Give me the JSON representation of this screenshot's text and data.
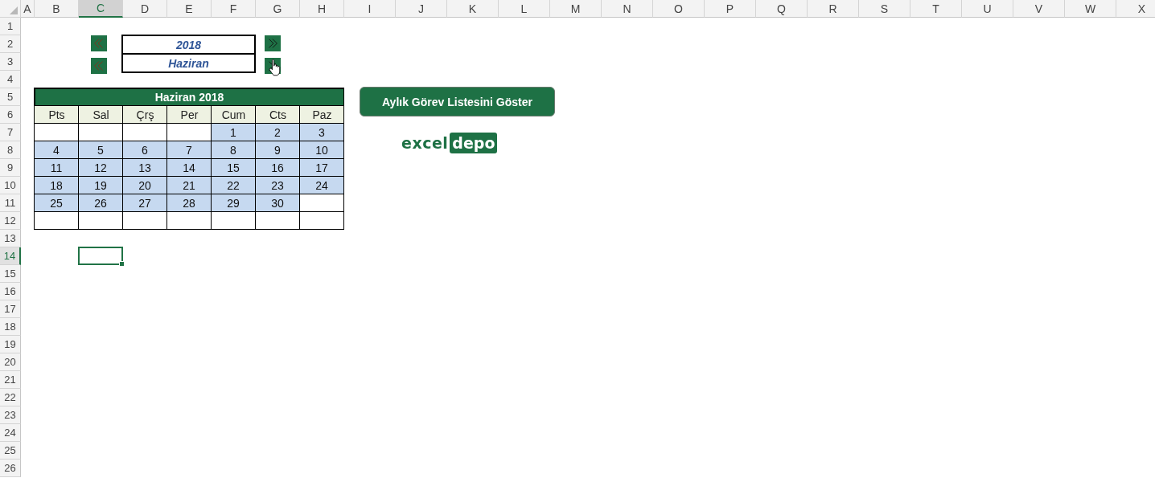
{
  "columns": [
    {
      "label": "A",
      "selected": false
    },
    {
      "label": "B",
      "selected": false
    },
    {
      "label": "C",
      "selected": true
    },
    {
      "label": "D",
      "selected": false
    },
    {
      "label": "E",
      "selected": false
    },
    {
      "label": "F",
      "selected": false
    },
    {
      "label": "G",
      "selected": false
    },
    {
      "label": "H",
      "selected": false
    },
    {
      "label": "I",
      "selected": false
    },
    {
      "label": "J",
      "selected": false
    },
    {
      "label": "K",
      "selected": false
    },
    {
      "label": "L",
      "selected": false
    },
    {
      "label": "M",
      "selected": false
    },
    {
      "label": "N",
      "selected": false
    },
    {
      "label": "O",
      "selected": false
    },
    {
      "label": "P",
      "selected": false
    },
    {
      "label": "Q",
      "selected": false
    },
    {
      "label": "R",
      "selected": false
    },
    {
      "label": "S",
      "selected": false
    },
    {
      "label": "T",
      "selected": false
    },
    {
      "label": "U",
      "selected": false
    },
    {
      "label": "V",
      "selected": false
    },
    {
      "label": "W",
      "selected": false
    },
    {
      "label": "X",
      "selected": false
    }
  ],
  "rows": [
    {
      "label": "1",
      "selected": false
    },
    {
      "label": "2",
      "selected": false
    },
    {
      "label": "3",
      "selected": false
    },
    {
      "label": "4",
      "selected": false
    },
    {
      "label": "5",
      "selected": false
    },
    {
      "label": "6",
      "selected": false
    },
    {
      "label": "7",
      "selected": false
    },
    {
      "label": "8",
      "selected": false
    },
    {
      "label": "9",
      "selected": false
    },
    {
      "label": "10",
      "selected": false
    },
    {
      "label": "11",
      "selected": false
    },
    {
      "label": "12",
      "selected": false
    },
    {
      "label": "13",
      "selected": false
    },
    {
      "label": "14",
      "selected": true
    },
    {
      "label": "15",
      "selected": false
    },
    {
      "label": "16",
      "selected": false
    },
    {
      "label": "17",
      "selected": false
    },
    {
      "label": "18",
      "selected": false
    },
    {
      "label": "19",
      "selected": false
    },
    {
      "label": "20",
      "selected": false
    },
    {
      "label": "21",
      "selected": false
    },
    {
      "label": "22",
      "selected": false
    },
    {
      "label": "23",
      "selected": false
    },
    {
      "label": "24",
      "selected": false
    },
    {
      "label": "25",
      "selected": false
    },
    {
      "label": "26",
      "selected": false
    }
  ],
  "selectors": [
    {
      "kind": "year",
      "value": "2018"
    },
    {
      "kind": "month",
      "value": "Haziran"
    }
  ],
  "calendar": {
    "title": "Haziran 2018",
    "weekdays": [
      "Pts",
      "Sal",
      "Çrş",
      "Per",
      "Cum",
      "Cts",
      "Paz"
    ],
    "weeks": [
      [
        {
          "in_month": false
        },
        {
          "in_month": false
        },
        {
          "in_month": false
        },
        {
          "in_month": false
        },
        {
          "day": "1",
          "in_month": true
        },
        {
          "day": "2",
          "in_month": true
        },
        {
          "day": "3",
          "in_month": true
        }
      ],
      [
        {
          "day": "4",
          "in_month": true
        },
        {
          "day": "5",
          "in_month": true
        },
        {
          "day": "6",
          "in_month": true
        },
        {
          "day": "7",
          "in_month": true
        },
        {
          "day": "8",
          "in_month": true
        },
        {
          "day": "9",
          "in_month": true
        },
        {
          "day": "10",
          "in_month": true
        }
      ],
      [
        {
          "day": "11",
          "in_month": true
        },
        {
          "day": "12",
          "in_month": true
        },
        {
          "day": "13",
          "in_month": true
        },
        {
          "day": "14",
          "in_month": true
        },
        {
          "day": "15",
          "in_month": true
        },
        {
          "day": "16",
          "in_month": true
        },
        {
          "day": "17",
          "in_month": true
        }
      ],
      [
        {
          "day": "18",
          "in_month": true
        },
        {
          "day": "19",
          "in_month": true
        },
        {
          "day": "20",
          "in_month": true
        },
        {
          "day": "21",
          "in_month": true
        },
        {
          "day": "22",
          "in_month": true
        },
        {
          "day": "23",
          "in_month": true
        },
        {
          "day": "24",
          "in_month": true
        }
      ],
      [
        {
          "day": "25",
          "in_month": true
        },
        {
          "day": "26",
          "in_month": true
        },
        {
          "day": "27",
          "in_month": true
        },
        {
          "day": "28",
          "in_month": true
        },
        {
          "day": "29",
          "in_month": true
        },
        {
          "day": "30",
          "in_month": true
        },
        {
          "in_month": false
        }
      ],
      [
        {
          "in_month": false
        },
        {
          "in_month": false
        },
        {
          "in_month": false
        },
        {
          "in_month": false
        },
        {
          "in_month": false
        },
        {
          "in_month": false
        },
        {
          "in_month": false
        }
      ]
    ]
  },
  "action_button": "Aylık Görev Listesini Göster",
  "logo": {
    "text": "excel",
    "badge": "depo"
  }
}
